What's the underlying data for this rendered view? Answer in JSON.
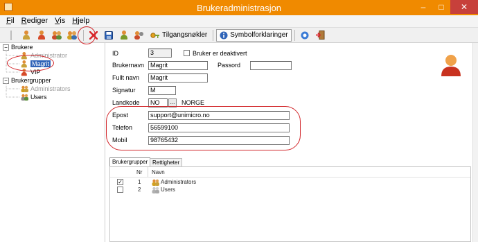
{
  "window": {
    "title": "Brukeradministrasjon",
    "minimize": "–",
    "maximize": "□",
    "close": "✕"
  },
  "menubar": [
    {
      "label": "Fil",
      "key": "F",
      "rest": "il"
    },
    {
      "label": "Rediger",
      "key": "R",
      "rest": "ediger"
    },
    {
      "label": "Vis",
      "key": "V",
      "rest": "is"
    },
    {
      "label": "Hjelp",
      "key": "H",
      "rest": "jelp"
    }
  ],
  "toolbar": {
    "keys_label": "Tilgangsnøkler",
    "symbols_label": "Symbolforklaringer"
  },
  "tree": {
    "users_root": "Brukere",
    "users": [
      "Administrator",
      "Magrit",
      "VIP"
    ],
    "selected_user": "Magrit",
    "groups_root": "Brukergrupper",
    "groups": [
      "Administrators",
      "Users"
    ],
    "toggle_expanded": "−"
  },
  "form": {
    "id_label": "ID",
    "id_value": "3",
    "deactivated_label": "Bruker er deaktivert",
    "username_label": "Brukernavn",
    "username_value": "Magrit",
    "password_label": "Passord",
    "password_value": "",
    "fullname_label": "Fullt navn",
    "fullname_value": "Magrit",
    "signature_label": "Signatur",
    "signature_value": "M",
    "country_label": "Landkode",
    "country_code": "NO",
    "country_browse": "...",
    "country_name": "NORGE",
    "email_label": "Epost",
    "email_value": "support@unimicro.no",
    "phone_label": "Telefon",
    "phone_value": "56599100",
    "mobile_label": "Mobil",
    "mobile_value": "98765432"
  },
  "tabs": [
    "Brukergrupper",
    "Rettigheter"
  ],
  "grid": {
    "headers": {
      "nr": "Nr",
      "name": "Navn"
    },
    "rows": [
      {
        "checked": true,
        "check_mark": "✓",
        "nr": "1",
        "name": "Administrators"
      },
      {
        "checked": false,
        "check_mark": "",
        "nr": "2",
        "name": "Users"
      }
    ]
  },
  "colors": {
    "titlebar": "#f08a00",
    "selection": "#3064b8",
    "annotation": "#d2262a"
  }
}
